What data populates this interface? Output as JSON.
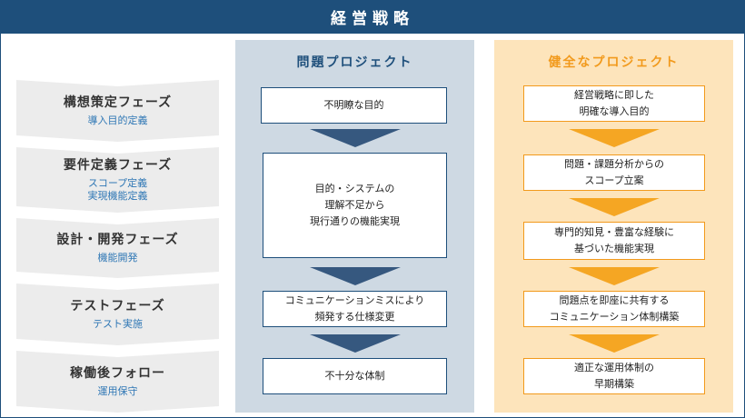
{
  "header": {
    "title": "経営戦略"
  },
  "phases": [
    {
      "title": "構想策定フェーズ",
      "subtitle": "導入目的定義"
    },
    {
      "title": "要件定義フェーズ",
      "subtitle": "スコープ定義\n実現機能定義"
    },
    {
      "title": "設計・開発フェーズ",
      "subtitle": "機能開発"
    },
    {
      "title": "テストフェーズ",
      "subtitle": "テスト実施"
    },
    {
      "title": "稼働後フォロー",
      "subtitle": "運用保守"
    }
  ],
  "problem_project": {
    "title": "問題プロジェクト",
    "steps": [
      "不明瞭な目的",
      "目的・システムの\n理解不足から\n現行通りの機能実現",
      "コミュニケーションミスにより\n頻発する仕様変更",
      "不十分な体制"
    ]
  },
  "healthy_project": {
    "title": "健全なプロジェクト",
    "steps": [
      "経営戦略に即した\n明確な導入目的",
      "問題・課題分析からの\nスコープ立案",
      "専門的知見・豊富な経験に\n基づいた機能実現",
      "問題点を即座に共有する\nコミュニケーション体制構築",
      "適正な運用体制の\n早期構築"
    ]
  },
  "colors": {
    "banner": "#1e4f7b",
    "problem_column": "#ced9e3",
    "problem_arrow": "#36587f",
    "healthy_column": "#fde4bb",
    "healthy_accent": "#f29a1c",
    "phase_text_accent": "#2f77b5"
  }
}
